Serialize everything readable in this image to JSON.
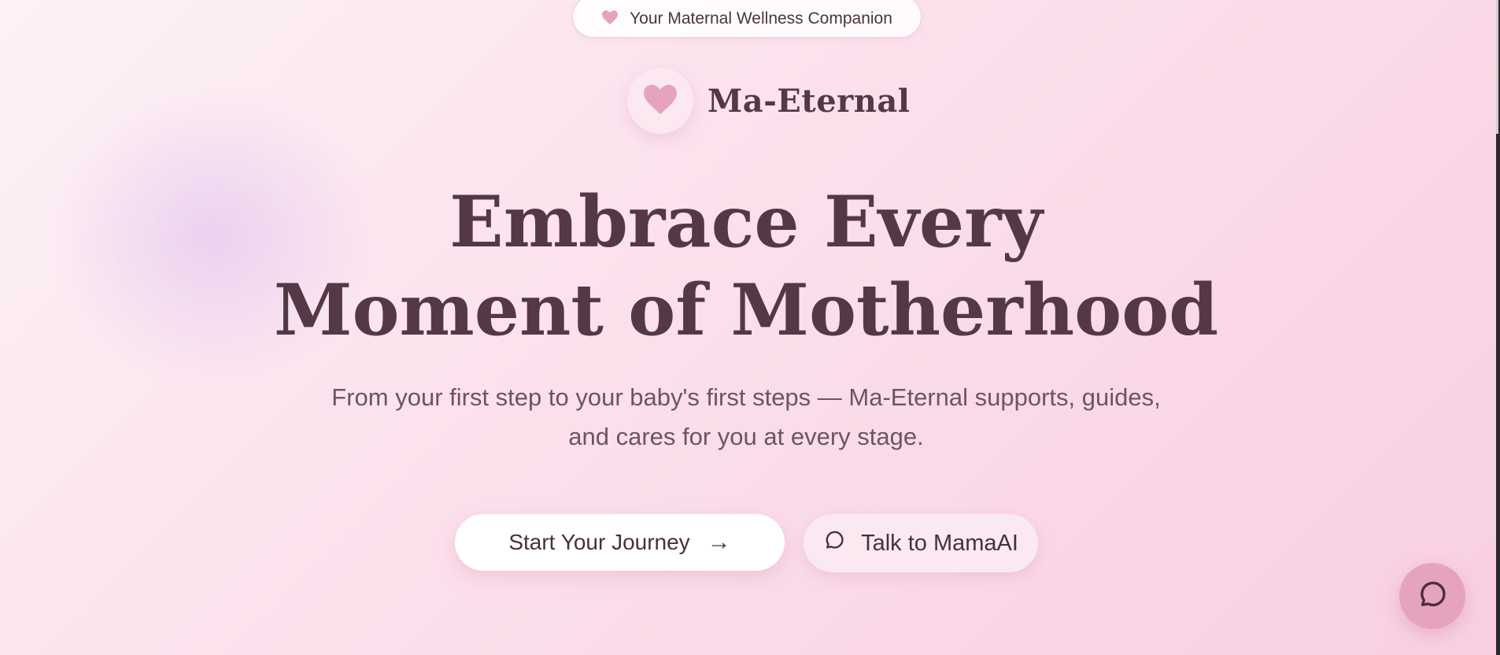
{
  "badge": {
    "icon": "heart-icon",
    "text": "Your Maternal Wellness Companion"
  },
  "brand": {
    "logo_icon": "heart-icon",
    "name": "Ma-Eternal"
  },
  "hero": {
    "headline_line1": "Embrace Every",
    "headline_line2": "Moment of Motherhood",
    "subtitle": "From your first step to your baby's first steps — Ma-Eternal supports, guides, and cares for you at every stage."
  },
  "actions": {
    "primary_label": "Start Your Journey",
    "primary_icon": "arrow-right-icon",
    "secondary_label": "Talk to MamaAI",
    "secondary_icon": "chat-bubble-icon"
  },
  "chat_fab": {
    "icon": "chat-bubble-icon"
  },
  "colors": {
    "accent_pink": "#e6a3c0",
    "heading": "#553846",
    "body_text": "#6e5462",
    "background_light": "#fdf1f6",
    "background_pink": "#f8cfe1"
  }
}
